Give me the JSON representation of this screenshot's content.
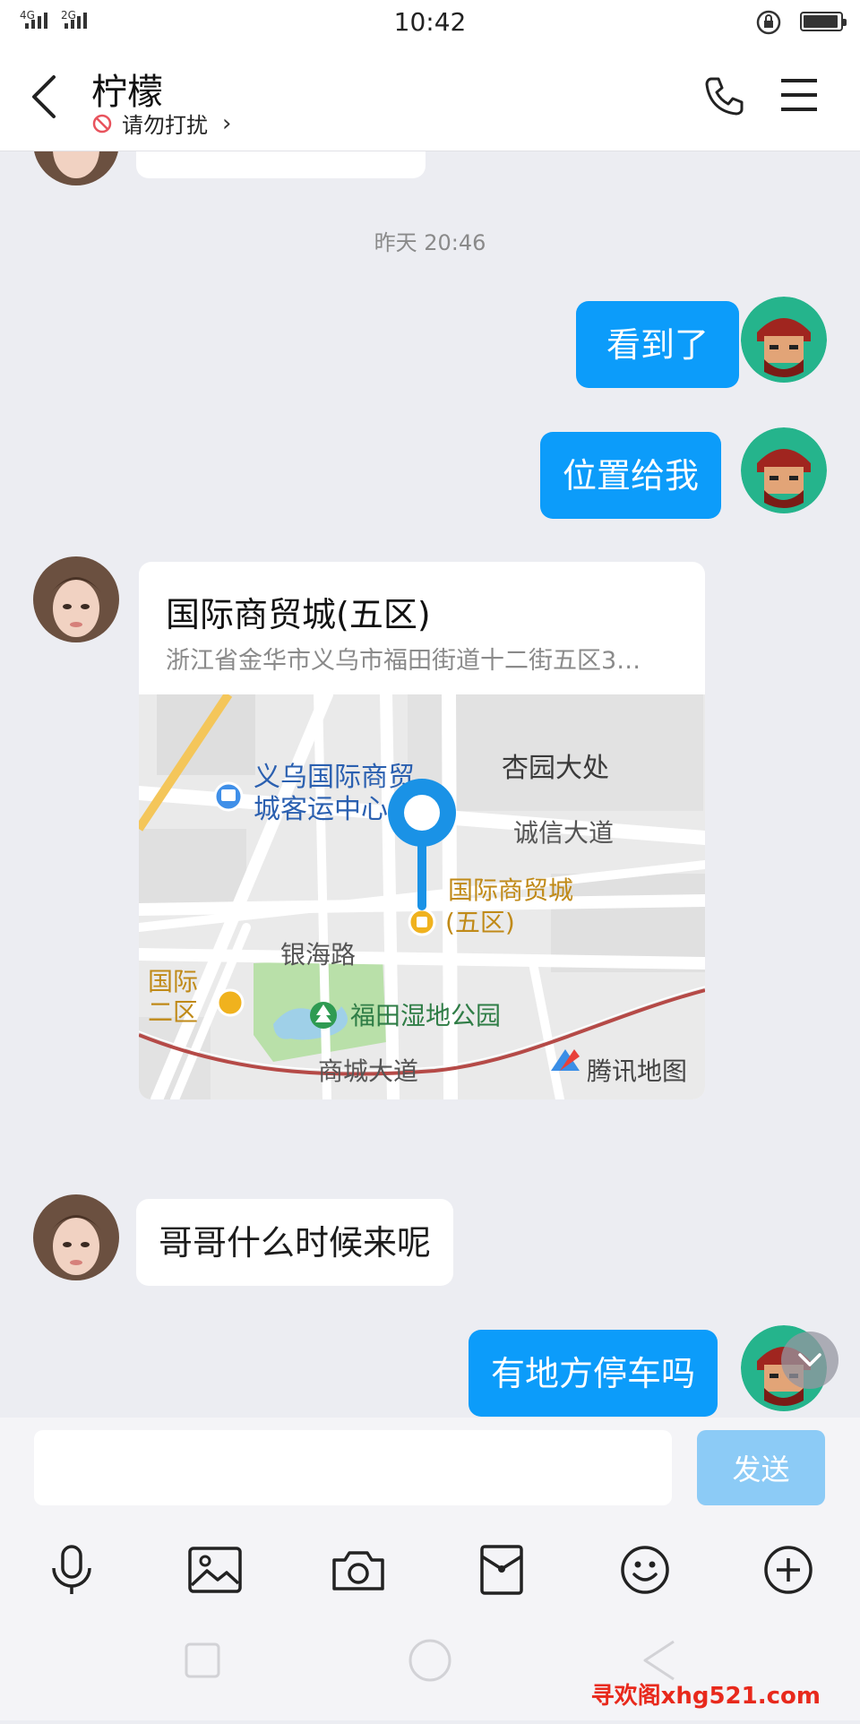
{
  "status_bar": {
    "network_label_1": "4G",
    "network_label_2": "2G",
    "time": "10:42",
    "battery_level": 0.95
  },
  "header": {
    "contact_name": "柠檬",
    "status_text": "请勿打扰"
  },
  "chat": {
    "timestamp": "昨天 20:46",
    "messages": [
      {
        "direction": "out",
        "text": "看到了"
      },
      {
        "direction": "out",
        "text": "位置给我"
      },
      {
        "direction": "in",
        "type": "location",
        "title": "国际商贸城(五区)",
        "address": "浙江省金华市义乌市福田街道十二街五区3…",
        "map": {
          "bus_station": "义乌国际商贸城客运中心",
          "bus_station_line1": "义乌国际商贸",
          "bus_station_line2": "城客运中心",
          "area_1": "杏园大处",
          "road_1": "诚信大道",
          "poi_line1": "国际商贸城",
          "poi_line2": "(五区)",
          "road_2": "银海路",
          "poi_left_line1": "国际",
          "poi_left_line2": "二区",
          "park": "福田湿地公园",
          "road_3": "商城大道",
          "provider": "腾讯地图"
        }
      },
      {
        "direction": "in",
        "text": "哥哥什么时候来呢"
      },
      {
        "direction": "out",
        "text": "有地方停车吗"
      }
    ]
  },
  "input": {
    "placeholder": "",
    "send_label": "发送"
  },
  "toolbar": [
    "microphone-icon",
    "image-icon",
    "camera-icon",
    "red-packet-icon",
    "emoji-icon",
    "plus-icon"
  ],
  "watermark": "寻欢阁xhg521.com",
  "colors": {
    "accent": "#0c9cfa",
    "send_disabled": "#8ccbf6",
    "background": "#ecedf2"
  }
}
